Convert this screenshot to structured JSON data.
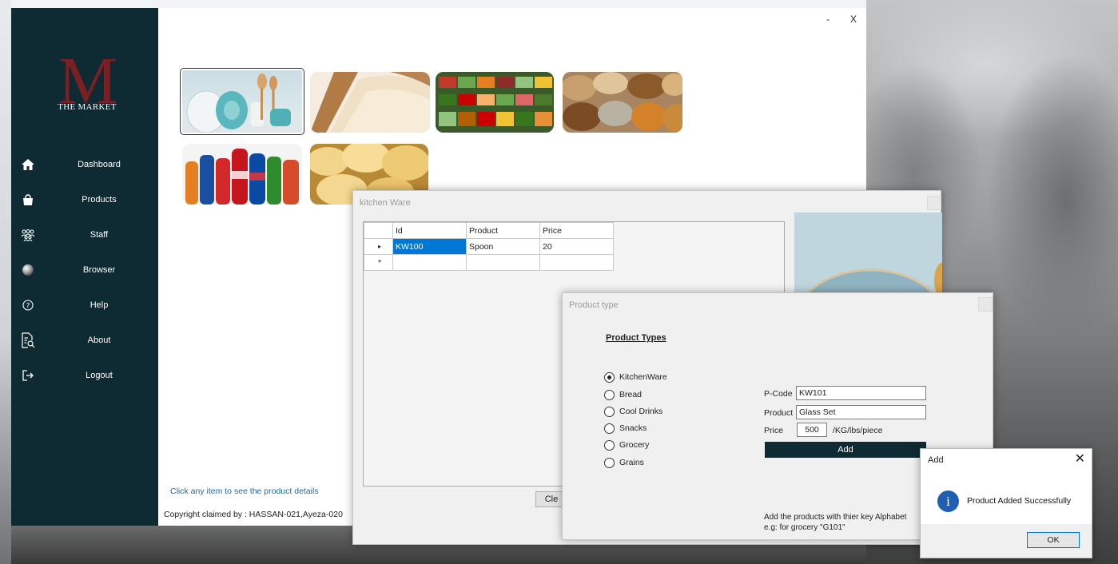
{
  "brand": {
    "logo_letter": "M",
    "name": "THE MARKET"
  },
  "sidebar": {
    "items": [
      {
        "label": "Dashboard",
        "icon": "home-icon"
      },
      {
        "label": "Products",
        "icon": "shopping-bag-icon"
      },
      {
        "label": "Staff",
        "icon": "people-icon"
      },
      {
        "label": "Browser",
        "icon": "globe-icon"
      },
      {
        "label": "Help",
        "icon": "help-icon"
      },
      {
        "label": "About",
        "icon": "document-search-icon"
      },
      {
        "label": "Logout",
        "icon": "logout-icon"
      }
    ]
  },
  "window_controls": {
    "minimize": "-",
    "close": "X"
  },
  "product_tiles": [
    {
      "category": "Kitchen Ware",
      "selected": true
    },
    {
      "category": "Bread",
      "selected": false
    },
    {
      "category": "Grocery",
      "selected": false
    },
    {
      "category": "Grains",
      "selected": false
    },
    {
      "category": "Cool Drinks",
      "selected": false
    },
    {
      "category": "Snacks",
      "selected": false
    }
  ],
  "main": {
    "hint": "Click any item to see the product details",
    "copyright": "Copyright claimed by : HASSAN-021,Ayeza-020"
  },
  "kitchen_ware": {
    "title": "kitchen Ware",
    "columns": [
      "Id",
      "Product",
      "Price"
    ],
    "rows": [
      {
        "id": "KW100",
        "product": "Spoon",
        "price": "20"
      }
    ],
    "new_row_marker": "*",
    "current_row_marker": "▸",
    "clear_button": "Cle"
  },
  "product_type": {
    "title": "Product type",
    "heading": "Product Types",
    "options": [
      "KitchenWare",
      "Bread",
      "Cool Drinks",
      "Snacks",
      "Grocery",
      "Grains"
    ],
    "selected_option": "KitchenWare",
    "pcode_label": "P-Code",
    "pcode_value": "KW101",
    "product_label": "Product",
    "product_value": "Glass Set",
    "price_label": "Price",
    "price_value": "500",
    "price_unit": "/KG/lbs/piece",
    "add_button": "Add",
    "note_line1": "Add the products with thier key Alphabet",
    "note_line2": "e.g: for grocery \"G101\""
  },
  "message_box": {
    "title": "Add",
    "close": "✕",
    "icon": "info-icon",
    "icon_glyph": "i",
    "message": "Product Added Successfully",
    "ok": "OK"
  },
  "colors": {
    "sidebar_bg": "#0e2a33",
    "accent": "#0078d7",
    "logo_red": "#7a1f23"
  }
}
